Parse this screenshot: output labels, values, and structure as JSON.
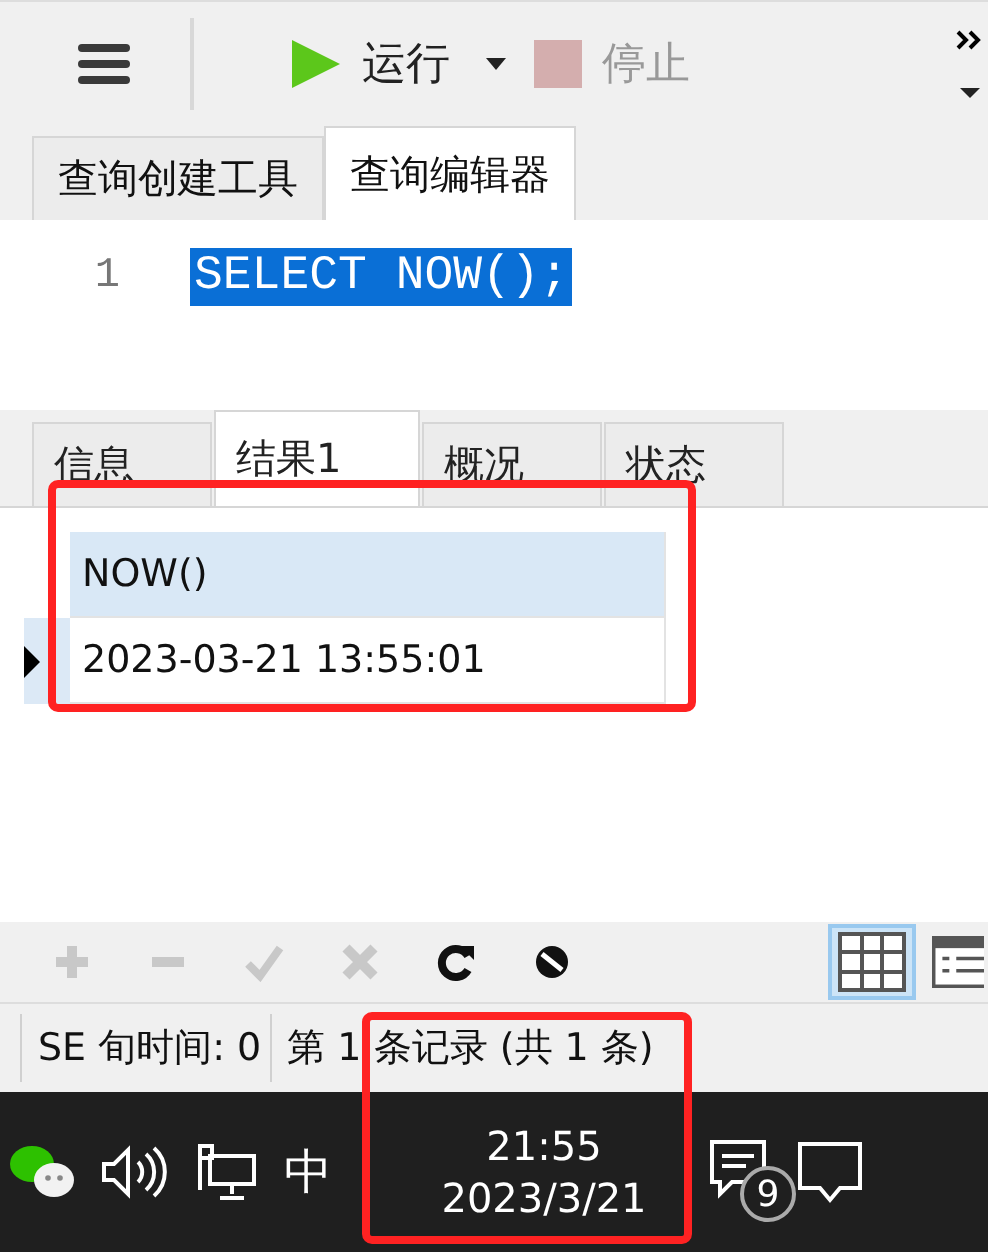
{
  "toolbar": {
    "run": {
      "label": "运行",
      "disabled": false
    },
    "stop": {
      "label": "停止",
      "disabled": true
    }
  },
  "editor_tabs": [
    {
      "label": "查询创建工具",
      "selected": false
    },
    {
      "label": "查询编辑器",
      "selected": true
    }
  ],
  "editor": {
    "lines": [
      {
        "number": "1",
        "code": "SELECT NOW();",
        "selected": true
      }
    ]
  },
  "result_tabs": [
    {
      "label": "信息",
      "selected": false
    },
    {
      "label": "结果1",
      "selected": true
    },
    {
      "label": "概况",
      "selected": false
    },
    {
      "label": "状态",
      "selected": false
    }
  ],
  "grid": {
    "columns": [
      "NOW()"
    ],
    "rows": [
      {
        "cells": [
          "2023-03-21 13:55:01"
        ],
        "current": true
      }
    ]
  },
  "grid_tools": [
    {
      "kind": "add",
      "disabled": true
    },
    {
      "kind": "delete",
      "disabled": true
    },
    {
      "kind": "apply",
      "disabled": true
    },
    {
      "kind": "discard",
      "disabled": true
    },
    {
      "kind": "refresh",
      "disabled": false
    },
    {
      "kind": "stop",
      "disabled": false
    }
  ],
  "views": [
    {
      "kind": "grid",
      "selected": true
    },
    {
      "kind": "form",
      "selected": false
    }
  ],
  "status_bar": [
    "SE 旬时间: 0",
    "第 1 条记录 (共 1 条)"
  ],
  "taskbar": {
    "ime": "中",
    "time": "21:55",
    "date": "2023/3/21",
    "notifications": "9"
  }
}
